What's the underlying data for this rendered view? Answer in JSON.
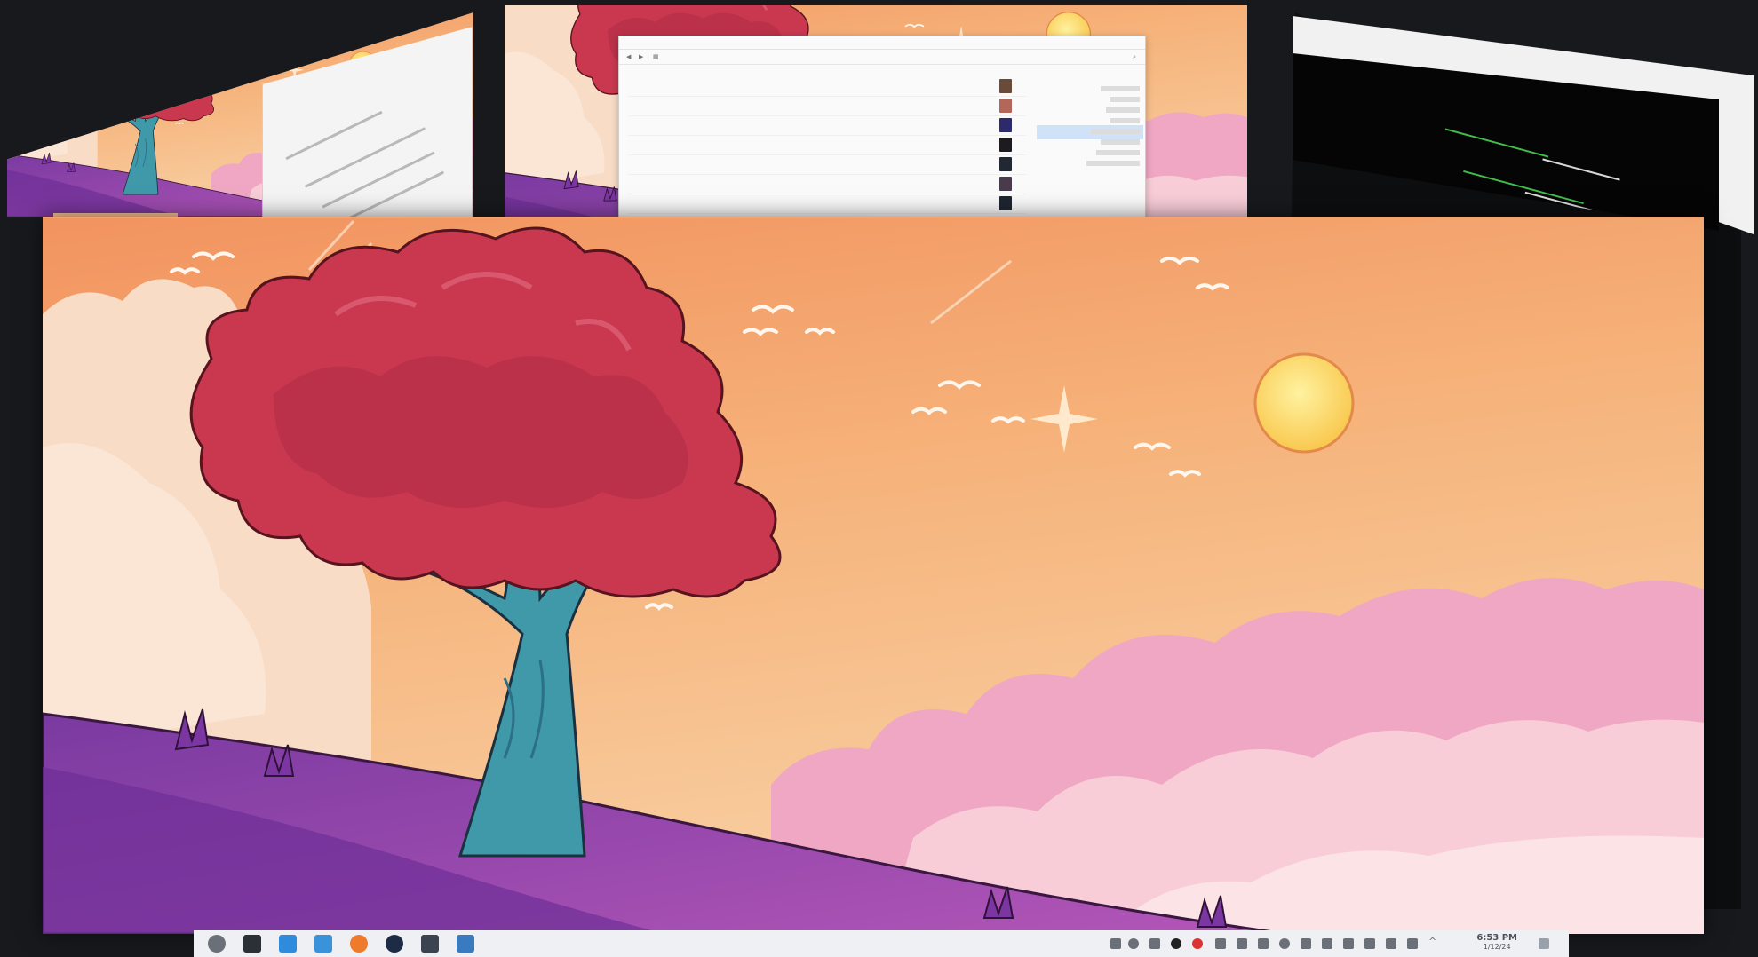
{
  "screen": {
    "effect": "desktop-cube-switcher",
    "background": "#17191d"
  },
  "wallpaper": {
    "sky_top": "#f39b63",
    "sky_mid": "#f6b77c",
    "sky_low": "#f8cfa0",
    "cloud": "#f7d6bf",
    "cloud_pink": "#ec9ec3",
    "tree_foliage": "#c7384e",
    "tree_trunk": "#3b98a6",
    "hill": "#8e3fa8",
    "sun": "#fde06a"
  },
  "back_left_window": {
    "lines": [
      "",
      "",
      "",
      ""
    ]
  },
  "file_manager": {
    "title": "",
    "toolbar_left": "",
    "rows": [
      {
        "name": "",
        "size": ""
      },
      {
        "name": "",
        "size": ""
      },
      {
        "name": "",
        "size": ""
      },
      {
        "name": "",
        "size": ""
      },
      {
        "name": "",
        "size": ""
      },
      {
        "name": "",
        "size": ""
      },
      {
        "name": "",
        "size": ""
      }
    ]
  },
  "taskbar": {
    "time": "6:53 PM",
    "date": "1/12/24",
    "apps": [
      {
        "icon": "launcher-icon"
      },
      {
        "icon": "terminal-icon"
      },
      {
        "icon": "discover-icon"
      },
      {
        "icon": "file-manager-icon"
      },
      {
        "icon": "firefox-icon"
      },
      {
        "icon": "steam-icon"
      },
      {
        "icon": "screen-capture-icon"
      },
      {
        "icon": "python-icon"
      }
    ],
    "tray": [
      "pen-icon",
      "clock-icon",
      "flameshot-icon",
      "steam-tray-icon",
      "record-icon",
      "device-icon",
      "usb-icon",
      "display-icon",
      "timer-icon",
      "clipboard-icon",
      "bluetooth-icon",
      "volume-icon",
      "battery-icon",
      "network-icon",
      "keyboard-icon",
      "chevron-up-icon"
    ]
  }
}
